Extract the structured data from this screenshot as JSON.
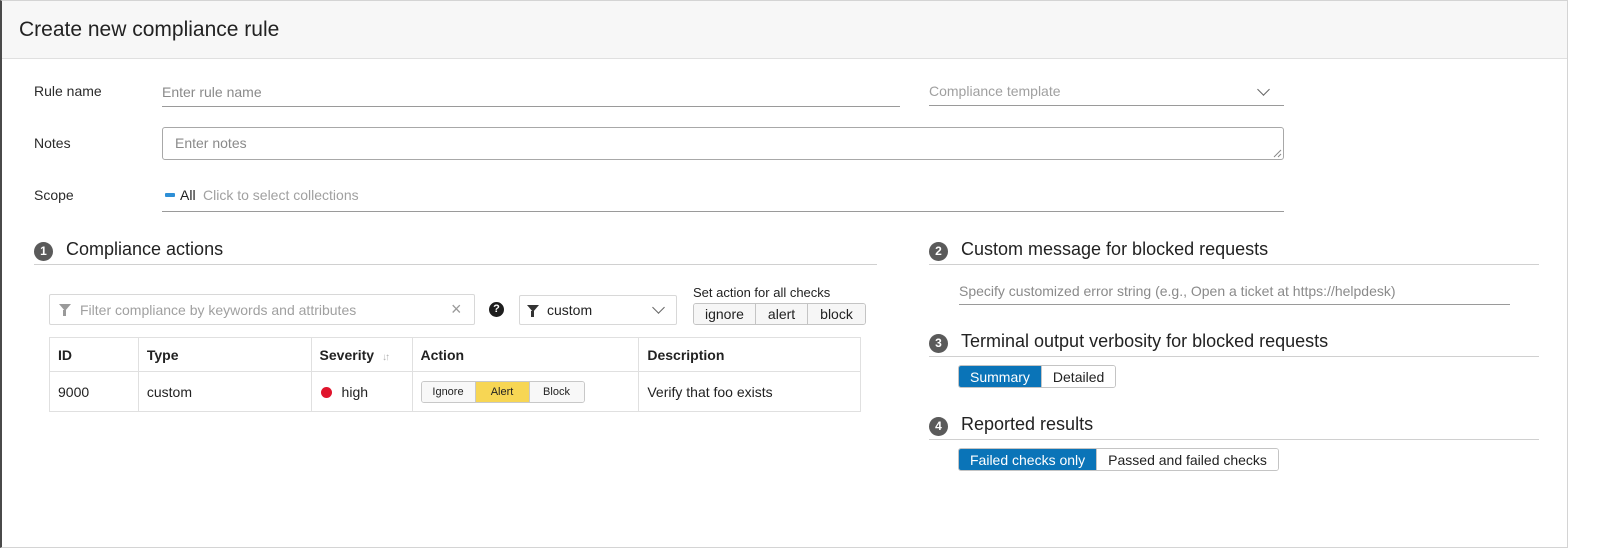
{
  "header": {
    "title": "Create new compliance rule"
  },
  "form": {
    "rule_name_label": "Rule name",
    "rule_name_placeholder": "Enter rule name",
    "template_placeholder": "Compliance template",
    "notes_label": "Notes",
    "notes_placeholder": "Enter notes",
    "scope_label": "Scope",
    "scope_value": "All",
    "scope_placeholder": "Click to select collections"
  },
  "sections": {
    "compliance_actions": {
      "number": "1",
      "title": "Compliance actions"
    },
    "custom_message": {
      "number": "2",
      "title": "Custom message for blocked requests",
      "placeholder": "Specify customized error string (e.g., Open a ticket at https://helpdesk)"
    },
    "verbosity": {
      "number": "3",
      "title": "Terminal output verbosity for blocked requests",
      "options": [
        "Summary",
        "Detailed"
      ],
      "selected": "Summary"
    },
    "reported": {
      "number": "4",
      "title": "Reported results",
      "options": [
        "Failed checks only",
        "Passed and failed checks"
      ],
      "selected": "Failed checks only"
    }
  },
  "toolbar": {
    "filter_placeholder": "Filter compliance by keywords and attributes",
    "clear_icon": "×",
    "help_icon": "?",
    "type_filter_value": "custom",
    "set_all_label": "Set action for all checks",
    "set_all_options": [
      "ignore",
      "alert",
      "block"
    ]
  },
  "table": {
    "columns": [
      "ID",
      "Type",
      "Severity",
      "Action",
      "Description"
    ],
    "sort_icon": "↓↑",
    "rows": [
      {
        "id": "9000",
        "type": "custom",
        "severity": "high",
        "severity_color": "#e0142c",
        "actions": [
          "Ignore",
          "Alert",
          "Block"
        ],
        "selected_action": "Alert",
        "description": "Verify that foo exists"
      }
    ]
  },
  "colors": {
    "primary": "#0a74b8",
    "selected_action": "#f7d654",
    "scope_dash": "#2e8fd6"
  }
}
